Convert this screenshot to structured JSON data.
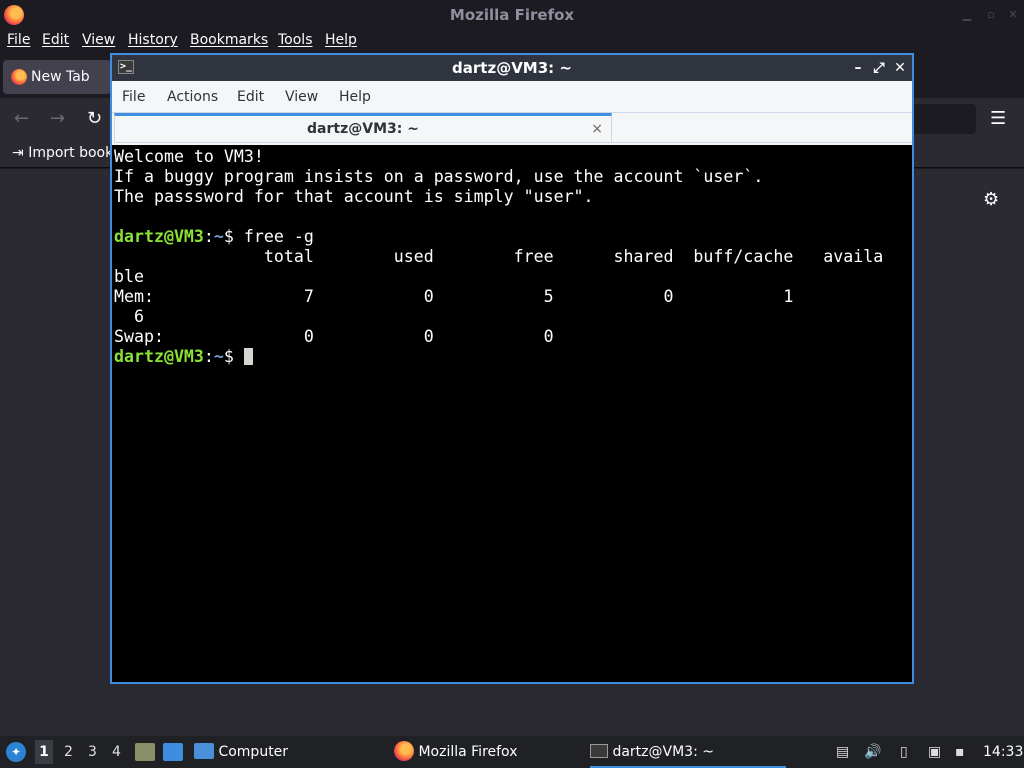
{
  "firefox": {
    "title": "Mozilla Firefox",
    "menu": [
      "File",
      "Edit",
      "View",
      "History",
      "Bookmarks",
      "Tools",
      "Help"
    ],
    "tab_label": "New Tab",
    "import_label": "Import book",
    "icons": {
      "back": "←",
      "forward": "→",
      "reload": "↻",
      "menu": "☰",
      "settings": "⚙"
    }
  },
  "terminal": {
    "title": "dartz@VM3: ~",
    "menu": [
      "File",
      "Actions",
      "Edit",
      "View",
      "Help"
    ],
    "tab_label": "dartz@VM3: ~",
    "tab_close": "×",
    "lines": [
      "Welcome to VM3!",
      "If a buggy program insists on a password, use the account `user`.",
      "The passsword for that account is simply \"user\".",
      "",
      "",
      "               total        used        free      shared  buff/cache   availa",
      "ble",
      "Mem:               7           0           5           0           1        ",
      "  6",
      "Swap:              0           0           0"
    ],
    "prompt_user": "dartz@VM3",
    "prompt_sep": ":",
    "prompt_path": "~",
    "prompt_dollar": "$ ",
    "command": "free -g"
  },
  "taskbar": {
    "workspaces": [
      "1",
      "2",
      "3",
      "4"
    ],
    "computer_label": "Computer",
    "firefox_label": "Mozilla Firefox",
    "terminal_label": "dartz@VM3: ~",
    "clock": "14:33"
  }
}
